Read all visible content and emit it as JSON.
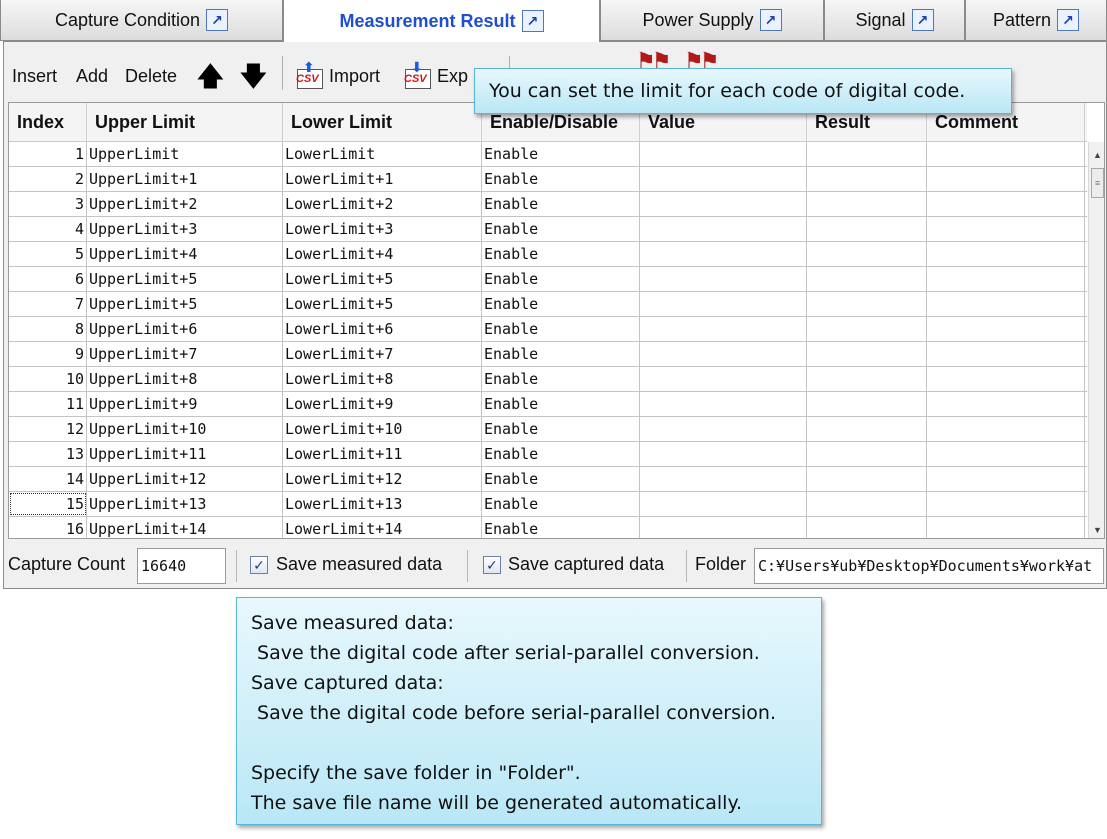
{
  "tabs": [
    {
      "label": "Capture Condition",
      "active": false
    },
    {
      "label": "Measurement Result",
      "active": true
    },
    {
      "label": "Power Supply",
      "active": false
    },
    {
      "label": "Signal",
      "active": false
    },
    {
      "label": "Pattern",
      "active": false
    }
  ],
  "toolbar": {
    "insert_label": "Insert",
    "add_label": "Add",
    "delete_label": "Delete",
    "up_arrow": "🡅",
    "down_arrow": "🡇",
    "import_label": "Import",
    "export_label": "Exp"
  },
  "table": {
    "headers": [
      "Index",
      "Upper Limit",
      "Lower Limit",
      "Enable/Disable",
      "Value",
      "Result",
      "Comment"
    ],
    "rows": [
      [
        "1",
        "UpperLimit",
        "LowerLimit",
        "Enable",
        "",
        "",
        ""
      ],
      [
        "2",
        "UpperLimit+1",
        "LowerLimit+1",
        "Enable",
        "",
        "",
        ""
      ],
      [
        "3",
        "UpperLimit+2",
        "LowerLimit+2",
        "Enable",
        "",
        "",
        ""
      ],
      [
        "4",
        "UpperLimit+3",
        "LowerLimit+3",
        "Enable",
        "",
        "",
        ""
      ],
      [
        "5",
        "UpperLimit+4",
        "LowerLimit+4",
        "Enable",
        "",
        "",
        ""
      ],
      [
        "6",
        "UpperLimit+5",
        "LowerLimit+5",
        "Enable",
        "",
        "",
        ""
      ],
      [
        "7",
        "UpperLimit+5",
        "LowerLimit+5",
        "Enable",
        "",
        "",
        ""
      ],
      [
        "8",
        "UpperLimit+6",
        "LowerLimit+6",
        "Enable",
        "",
        "",
        ""
      ],
      [
        "9",
        "UpperLimit+7",
        "LowerLimit+7",
        "Enable",
        "",
        "",
        ""
      ],
      [
        "10",
        "UpperLimit+8",
        "LowerLimit+8",
        "Enable",
        "",
        "",
        ""
      ],
      [
        "11",
        "UpperLimit+9",
        "LowerLimit+9",
        "Enable",
        "",
        "",
        ""
      ],
      [
        "12",
        "UpperLimit+10",
        "LowerLimit+10",
        "Enable",
        "",
        "",
        ""
      ],
      [
        "13",
        "UpperLimit+11",
        "LowerLimit+11",
        "Enable",
        "",
        "",
        ""
      ],
      [
        "14",
        "UpperLimit+12",
        "LowerLimit+12",
        "Enable",
        "",
        "",
        ""
      ],
      [
        "15",
        "UpperLimit+13",
        "LowerLimit+13",
        "Enable",
        "",
        "",
        ""
      ],
      [
        "16",
        "UpperLimit+14",
        "LowerLimit+14",
        "Enable",
        "",
        "",
        ""
      ]
    ]
  },
  "status": {
    "capture_count_label": "Capture Count",
    "capture_count_value": "16640",
    "save_measured_label": "Save measured data",
    "save_measured_checked": true,
    "save_captured_label": "Save captured data",
    "save_captured_checked": true,
    "folder_label": "Folder",
    "folder_value": "C:¥Users¥ub¥Desktop¥Documents¥work¥at"
  },
  "callouts": {
    "limit_note": "You can set the limit for each code of digital code.",
    "save_note_lines": [
      "Save measured data:",
      " Save the digital code after serial-parallel conversion.",
      "Save captured data:",
      " Save the digital code before serial-parallel conversion.",
      "",
      "Specify the save folder in \"Folder\".",
      "The save file name will be generated automatically."
    ]
  },
  "icons": {
    "tab_popout": "popout-icon",
    "csv_import": "csv-import-icon",
    "csv_export": "csv-export-icon",
    "check_mark": "✓",
    "scroll_up": "▲",
    "scroll_down": "▼",
    "scroll_grip": "≡"
  }
}
